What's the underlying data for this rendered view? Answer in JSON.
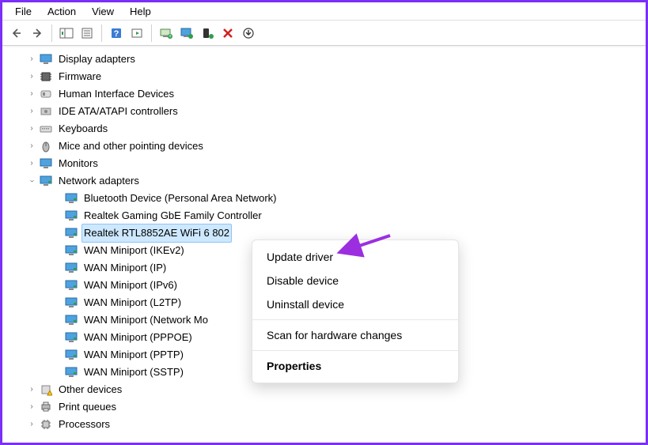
{
  "menubar": {
    "file": "File",
    "action": "Action",
    "view": "View",
    "help": "Help"
  },
  "tree": {
    "display_adapters": "Display adapters",
    "firmware": "Firmware",
    "hid": "Human Interface Devices",
    "ide": "IDE ATA/ATAPI controllers",
    "keyboards": "Keyboards",
    "mice": "Mice and other pointing devices",
    "monitors": "Monitors",
    "network_adapters": "Network adapters",
    "net_bt": "Bluetooth Device (Personal Area Network)",
    "net_gbe": "Realtek Gaming GbE Family Controller",
    "net_wifi": "Realtek RTL8852AE WiFi 6 802",
    "net_ikev2": "WAN Miniport (IKEv2)",
    "net_ip": "WAN Miniport (IP)",
    "net_ipv6": "WAN Miniport (IPv6)",
    "net_l2tp": "WAN Miniport (L2TP)",
    "net_netmon": "WAN Miniport (Network Mo",
    "net_pppoe": "WAN Miniport (PPPOE)",
    "net_pptp": "WAN Miniport (PPTP)",
    "net_sstp": "WAN Miniport (SSTP)",
    "other_devices": "Other devices",
    "print_queues": "Print queues",
    "processors": "Processors"
  },
  "context_menu": {
    "update_driver": "Update driver",
    "disable_device": "Disable device",
    "uninstall_device": "Uninstall device",
    "scan": "Scan for hardware changes",
    "properties": "Properties"
  }
}
